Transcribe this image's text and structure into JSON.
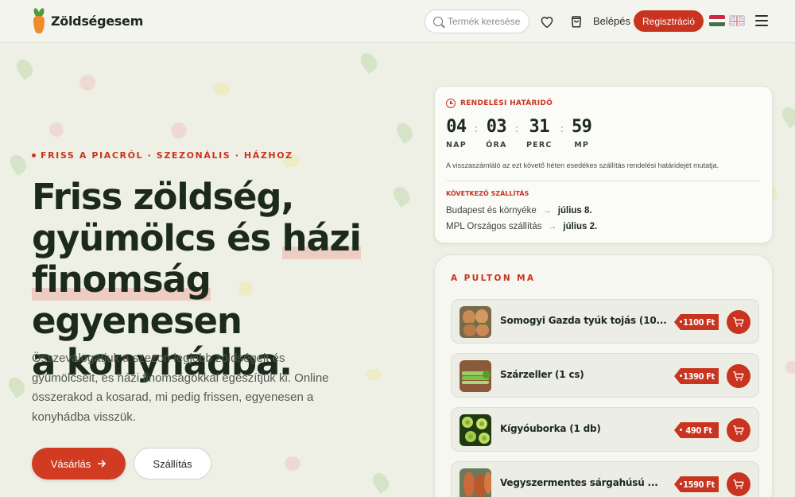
{
  "brand": {
    "name": "Zöldségesem"
  },
  "header": {
    "search_placeholder": "Termék keresése",
    "login": "Belépés",
    "register": "Regisztráció"
  },
  "hero": {
    "tagline": "FRISS A PIACRÓL · SZEZONÁLIS · HÁZHOZ",
    "title_parts": [
      "Friss zöldség,",
      "gyümölcs és ",
      "házi",
      "finomság",
      " egyenesen",
      "a konyhádba."
    ],
    "description": "Összeválogatjuk a szezon legjobb zöldségeit és gyümölcseit, és házi finomságokkal egészítjük ki. Online összerakod a kosarad, mi pedig frissen, egyenesen a konyhádba visszük.",
    "shop_button": "Vásárlás",
    "shipping_button": "Szállítás"
  },
  "countdown": {
    "heading": "RENDELÉSI HATÁRIDŐ",
    "units": [
      {
        "value": "04",
        "label": "NAP"
      },
      {
        "value": "03",
        "label": "ÓRA"
      },
      {
        "value": "31",
        "label": "PERC"
      },
      {
        "value": "59",
        "label": "MP"
      }
    ],
    "separator": ":",
    "note": "A visszaszámláló az ezt követő héten esedékes szállítás rendelési határidejét mutatja.",
    "next_heading": "KÖVETKEZŐ SZÁLLÍTÁS",
    "shipments": [
      {
        "region": "Budapest és környéke",
        "date": "július 8."
      },
      {
        "region": "MPL Országos szállítás",
        "date": "július 2."
      }
    ]
  },
  "products": {
    "heading": "A PULTON MA",
    "items": [
      {
        "name": "Somogyi Gazda tyúk tojás (10...",
        "price": "1100 Ft",
        "image": "eggs"
      },
      {
        "name": "Szárzeller (1 cs)",
        "price": "1390 Ft",
        "image": "celery"
      },
      {
        "name": "Kígyóuborka (1 db)",
        "price": "490 Ft",
        "image": "cucumber"
      },
      {
        "name": "Vegyszermentes sárgahúsú ...",
        "price": "1590 Ft",
        "image": "sweet-potato"
      }
    ]
  },
  "icons": {
    "search": "search-icon",
    "heart": "heart-icon",
    "cart": "shopping-bag-icon",
    "menu": "hamburger-menu-icon",
    "clock": "clock-icon",
    "arrow": "arrow-right-icon",
    "add_to_cart": "cart-icon"
  },
  "colors": {
    "accent": "#c8341f",
    "background": "#eef0e6",
    "brand_orange": "#f08a2c",
    "brand_green": "#4f9a3a"
  }
}
